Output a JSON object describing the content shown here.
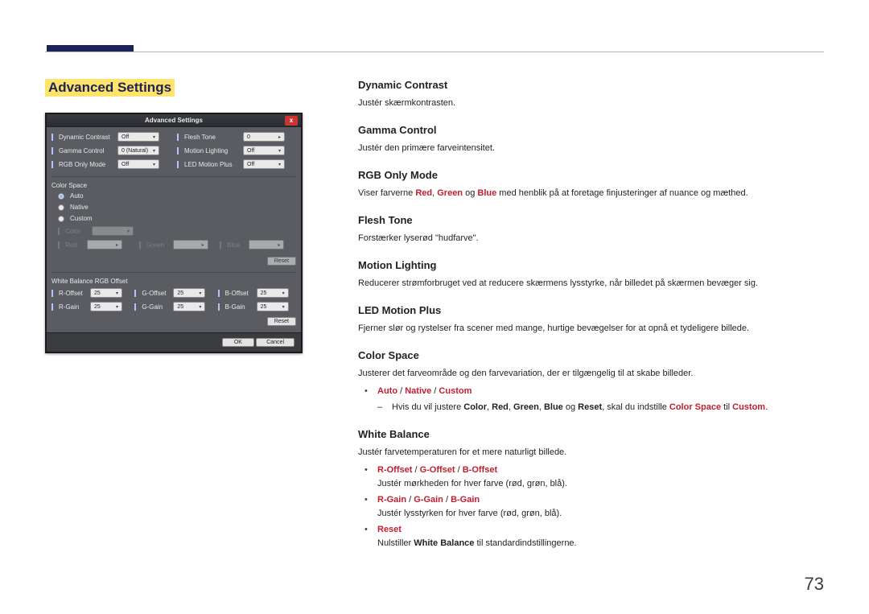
{
  "page_number": "73",
  "heading": "Advanced Settings",
  "panel": {
    "title": "Advanced Settings",
    "close": "x",
    "rows_top_left": [
      {
        "label": "Dynamic Contrast",
        "value": "Off"
      },
      {
        "label": "Gamma Control",
        "value": "0 (Natural)"
      },
      {
        "label": "RGB Only Mode",
        "value": "Off"
      }
    ],
    "rows_top_right": [
      {
        "label": "Flesh Tone",
        "value": "0"
      },
      {
        "label": "Motion Lighting",
        "value": "Off"
      },
      {
        "label": "LED Motion Plus",
        "value": "Off"
      }
    ],
    "color_space": {
      "header": "Color Space",
      "options": [
        "Auto",
        "Native",
        "Custom"
      ],
      "selected": 0,
      "disabled_row": {
        "color_label": "Color",
        "red_label": "Red",
        "green_label": "Green",
        "blue_label": "Blue"
      },
      "reset": "Reset"
    },
    "white_balance": {
      "header": "White Balance RGB Offset",
      "left": [
        {
          "label": "R-Offset",
          "value": "25"
        },
        {
          "label": "R-Gain",
          "value": "25"
        }
      ],
      "mid": [
        {
          "label": "G-Offset",
          "value": "25"
        },
        {
          "label": "G-Gain",
          "value": "25"
        }
      ],
      "right": [
        {
          "label": "B-Offset",
          "value": "25"
        },
        {
          "label": "B-Gain",
          "value": "25"
        }
      ],
      "reset": "Reset"
    },
    "ok": "OK",
    "cancel": "Cancel"
  },
  "sections": {
    "dynamic_contrast": {
      "title": "Dynamic Contrast",
      "body": "Justér skærmkontrasten."
    },
    "gamma_control": {
      "title": "Gamma Control",
      "body": "Justér den primære farveintensitet."
    },
    "rgb_only_mode": {
      "title": "RGB Only Mode",
      "pre": "Viser farverne ",
      "red": "Red",
      "sep1": ", ",
      "green": "Green",
      "sep2": " og ",
      "blue": "Blue",
      "post": " med henblik på at foretage finjusteringer af nuance og mæthed."
    },
    "flesh_tone": {
      "title": "Flesh Tone",
      "body": "Forstærker lyserød \"hudfarve\"."
    },
    "motion_lighting": {
      "title": "Motion Lighting",
      "body": "Reducerer strømforbruget ved at reducere skærmens lysstyrke, når billedet på skærmen bevæger sig."
    },
    "led_motion_plus": {
      "title": "LED Motion Plus",
      "body": "Fjerner slør og rystelser fra scener med mange, hurtige bevægelser for at opnå et tydeligere billede."
    },
    "color_space": {
      "title": "Color Space",
      "body": "Justerer det farveområde og den farvevariation, der er tilgængelig til at skabe billeder.",
      "b_auto": "Auto",
      "b_slash": " / ",
      "b_native": "Native",
      "b_custom": "Custom",
      "sub_pre": "Hvis du vil justere ",
      "sub_color": "Color",
      "c": ", ",
      "sub_red": "Red",
      "sub_green": "Green",
      "sub_blue": "Blue",
      "sub_and": " og ",
      "sub_reset": "Reset",
      "sub_mid": ", skal du indstille ",
      "sub_cs": "Color Space",
      "sub_to": " til ",
      "sub_custom": "Custom",
      "dot": "."
    },
    "white_balance": {
      "title": "White Balance",
      "body": "Justér farvetemperaturen for et mere naturligt billede.",
      "line1": {
        "ro": "R-Offset",
        "s": " / ",
        "go": "G-Offset",
        "bo": "B-Offset",
        "desc": "Justér mørkheden for hver farve (rød, grøn, blå)."
      },
      "line2": {
        "rg": "R-Gain",
        "s": " / ",
        "gg": "G-Gain",
        "bg": "B-Gain",
        "desc": "Justér lysstyrken for hver farve (rød, grøn, blå)."
      },
      "line3": {
        "reset": "Reset",
        "desc_pre": "Nulstiller ",
        "wb": "White Balance",
        "desc_post": " til standardindstillingerne."
      }
    }
  }
}
